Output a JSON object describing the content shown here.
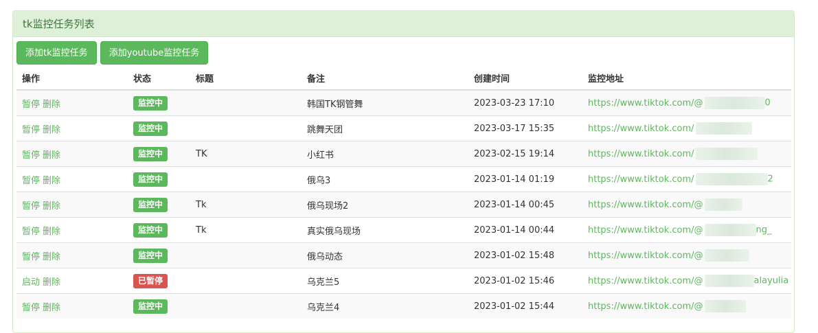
{
  "panel": {
    "title": "tk监控任务列表"
  },
  "toolbar": {
    "add_tk": "添加tk监控任务",
    "add_youtube": "添加youtube监控任务"
  },
  "table": {
    "headers": [
      "操作",
      "状态",
      "标题",
      "备注",
      "创建时间",
      "监控地址"
    ],
    "rows": [
      {
        "action1": "暂停",
        "action2": "删除",
        "status": "监控中",
        "status_kind": "on",
        "title": "",
        "note": "韩国TK钢管舞",
        "created": "2023-03-23 17:10",
        "url": "https://www.tiktok.com/@",
        "url_tail": "0"
      },
      {
        "action1": "暂停",
        "action2": "删除",
        "status": "监控中",
        "status_kind": "on",
        "title": "",
        "note": "跳舞天团",
        "created": "2023-03-17 15:35",
        "url": "https://www.tiktok.com/",
        "url_tail": ""
      },
      {
        "action1": "暂停",
        "action2": "删除",
        "status": "监控中",
        "status_kind": "on",
        "title": "TK",
        "note": "小红书",
        "created": "2023-02-15 19:14",
        "url": "https://www.tiktok.com/",
        "url_tail": ""
      },
      {
        "action1": "暂停",
        "action2": "删除",
        "status": "监控中",
        "status_kind": "on",
        "title": "",
        "note": "俄乌3",
        "created": "2023-01-14 01:19",
        "url": "https://www.tiktok.com/",
        "url_tail": "2"
      },
      {
        "action1": "暂停",
        "action2": "删除",
        "status": "监控中",
        "status_kind": "on",
        "title": "Tk",
        "note": "俄乌现场2",
        "created": "2023-01-14 00:45",
        "url": "https://www.tiktok.com/@",
        "url_tail": ""
      },
      {
        "action1": "暂停",
        "action2": "删除",
        "status": "监控中",
        "status_kind": "on",
        "title": "Tk",
        "note": "真实俄乌现场",
        "created": "2023-01-14 00:44",
        "url": "https://www.tiktok.com/@",
        "url_tail": "ng_"
      },
      {
        "action1": "暂停",
        "action2": "删除",
        "status": "监控中",
        "status_kind": "on",
        "title": "",
        "note": "俄乌动态",
        "created": "2023-01-02 15:48",
        "url": "https://www.tiktok.com/@",
        "url_tail": ""
      },
      {
        "action1": "启动",
        "action2": "删除",
        "status": "已暂停",
        "status_kind": "off",
        "title": "",
        "note": "乌克兰5",
        "created": "2023-01-02 15:46",
        "url": "https://www.tiktok.com/@",
        "url_tail": "alayulia"
      },
      {
        "action1": "暂停",
        "action2": "删除",
        "status": "监控中",
        "status_kind": "on",
        "title": "",
        "note": "乌克兰4",
        "created": "2023-01-02 15:44",
        "url": "https://www.tiktok.com/@",
        "url_tail": ""
      }
    ]
  },
  "colors": {
    "accent": "#5cb85c",
    "danger": "#d9534f",
    "panel_bg": "#dff0d8"
  }
}
